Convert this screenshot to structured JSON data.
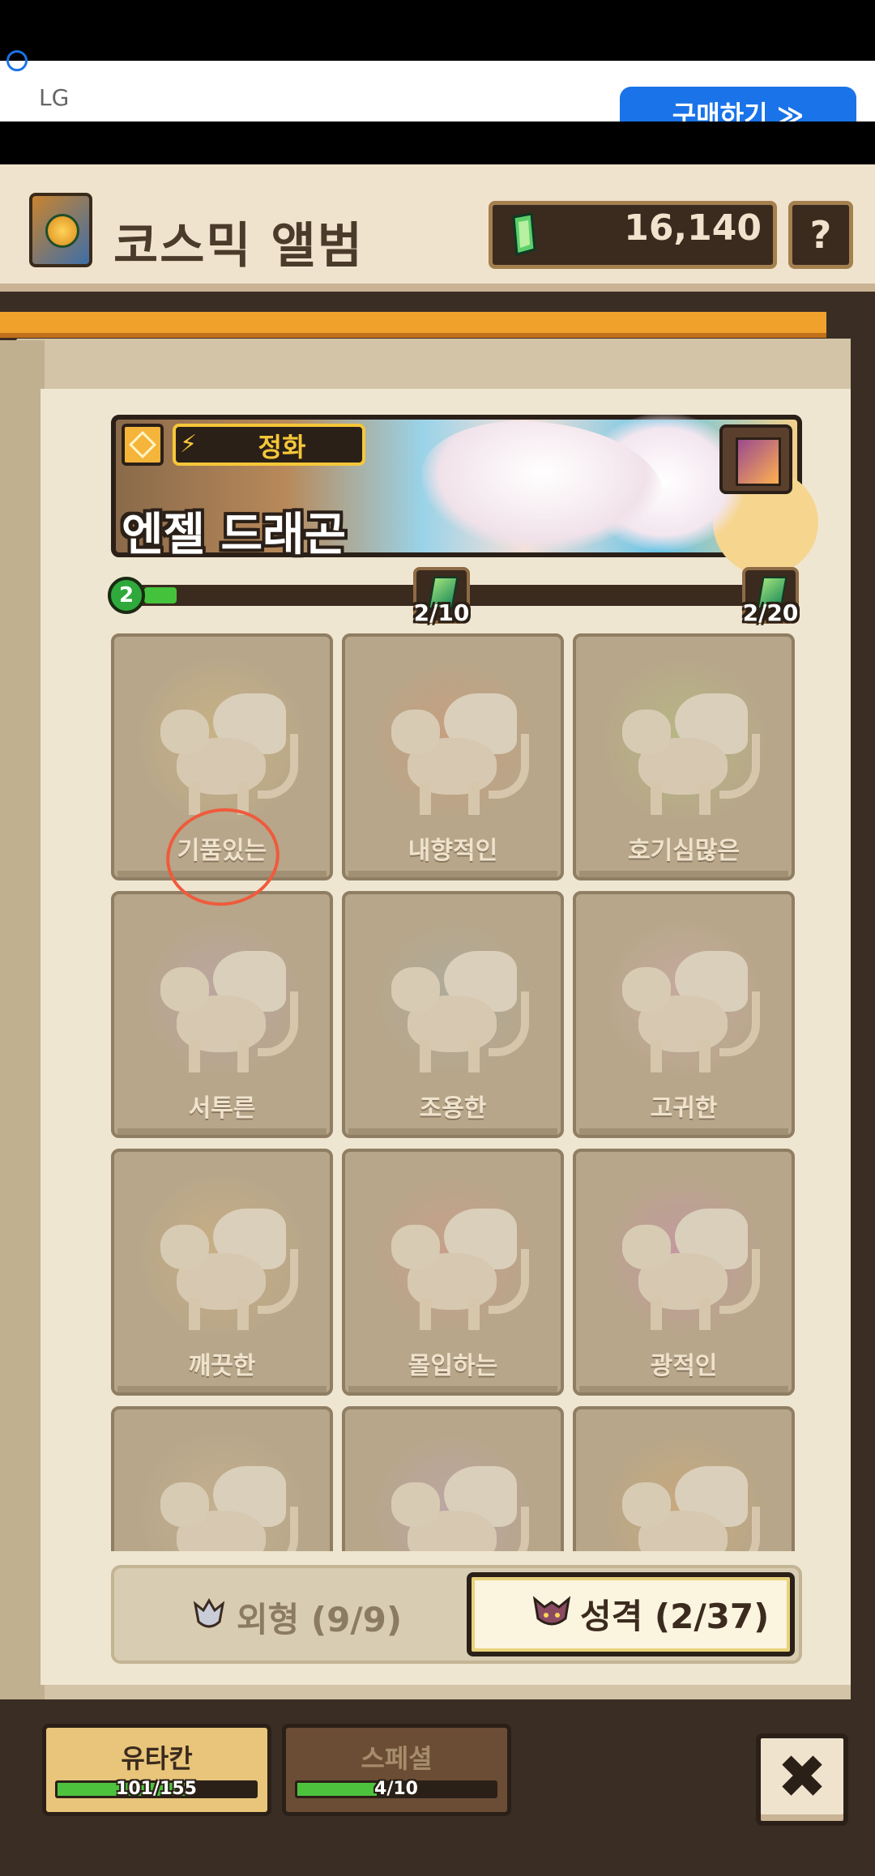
{
  "ad": {
    "brand": "LG",
    "cta": "구매하기 ≫"
  },
  "header": {
    "title": "코스믹 앨범",
    "currency": "16,140",
    "help": "?"
  },
  "creature": {
    "type": "정화",
    "name": "엔젤 드래곤"
  },
  "progress": {
    "level": "2",
    "fraction": 0.02,
    "milestones": [
      {
        "label": "2/10"
      },
      {
        "label": "2/20"
      }
    ]
  },
  "cards": [
    {
      "label": "기품있는",
      "glow": "#f3d27a"
    },
    {
      "label": "내향적인",
      "glow": "#ef8a6a"
    },
    {
      "label": "호기심많은",
      "glow": "#b6e07a"
    },
    {
      "label": "서투른",
      "glow": "#c8a8e0"
    },
    {
      "label": "조용한",
      "glow": "#9ab7c8"
    },
    {
      "label": "고귀한",
      "glow": "#e8b2d6"
    },
    {
      "label": "깨끗한",
      "glow": "#f2c27a"
    },
    {
      "label": "몰입하는",
      "glow": "#ef8f8a"
    },
    {
      "label": "광적인",
      "glow": "#e07ad8"
    },
    {
      "label": "",
      "glow": "#e8c8a0"
    },
    {
      "label": "",
      "glow": "#c8a8e8"
    },
    {
      "label": "",
      "glow": "#f0b060"
    }
  ],
  "tabs": {
    "appearance": "외형 (9/9)",
    "personality": "성격 (2/37)"
  },
  "bottom": {
    "category1": {
      "label": "유타칸",
      "count": "101/155",
      "fraction": 0.65
    },
    "category2": {
      "label": "스페셜",
      "count": "4/10",
      "fraction": 0.4
    },
    "close": "✖"
  }
}
